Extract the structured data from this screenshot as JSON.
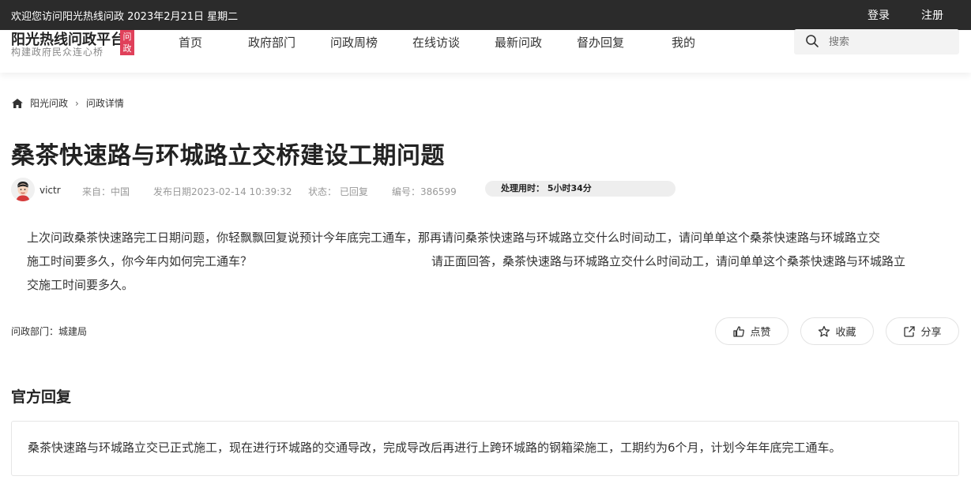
{
  "topbar": {
    "welcome": "欢迎您访问阳光热线问政 2023年2月21日 星期二",
    "login": "登录",
    "register": "注册"
  },
  "logo": {
    "main": "阳光热线问政平台",
    "sub": "构建政府民众连心桥",
    "badge": "问政"
  },
  "nav": [
    "首页",
    "政府部门",
    "问政周榜",
    "在线访谈",
    "最新问政",
    "督办回复",
    "我的"
  ],
  "search": {
    "placeholder": "搜索",
    "icon": "search-icon"
  },
  "breadcrumb": {
    "home": "阳光问政",
    "current": "问政详情"
  },
  "article": {
    "title": "桑茶快速路与环城路立交桥建设工期问题",
    "author": "victr",
    "source": "来自：中国",
    "date": "发布日期2023-02-14 10:39:32",
    "status": "状态：  已回复",
    "number": "编号：386599",
    "duration": "处理用时：  5小时34分",
    "body_line1": "上次问政桑茶快速路完工日期问题，你轻飘飘回复说预计今年底完工通车，那再请问桑茶快速路与环城路立交什么时间动工，请问单单这个桑茶快速路与环城路立交",
    "body_line2a": "施工时间要多久，你今年内如何完工通车？",
    "body_line2b": "请正面回答，桑茶快速路与环城路立交什么时间动工，请问单单这个桑茶快速路与环城路立",
    "body_line3": "交施工时间要多久。",
    "dept": "问政部门：城建局"
  },
  "actions": {
    "like": "点赞",
    "favorite": "收藏",
    "share": "分享"
  },
  "reply": {
    "heading": "官方回复",
    "text": "桑茶快速路与环城路立交已正式施工，现在进行环城路的交通导改，完成导改后再进行上跨环城路的钢箱梁施工，工期约为6个月，计划今年年底完工通车。"
  },
  "colors": {
    "topbar": "#2b2b2b",
    "badge": "#e0405a"
  }
}
